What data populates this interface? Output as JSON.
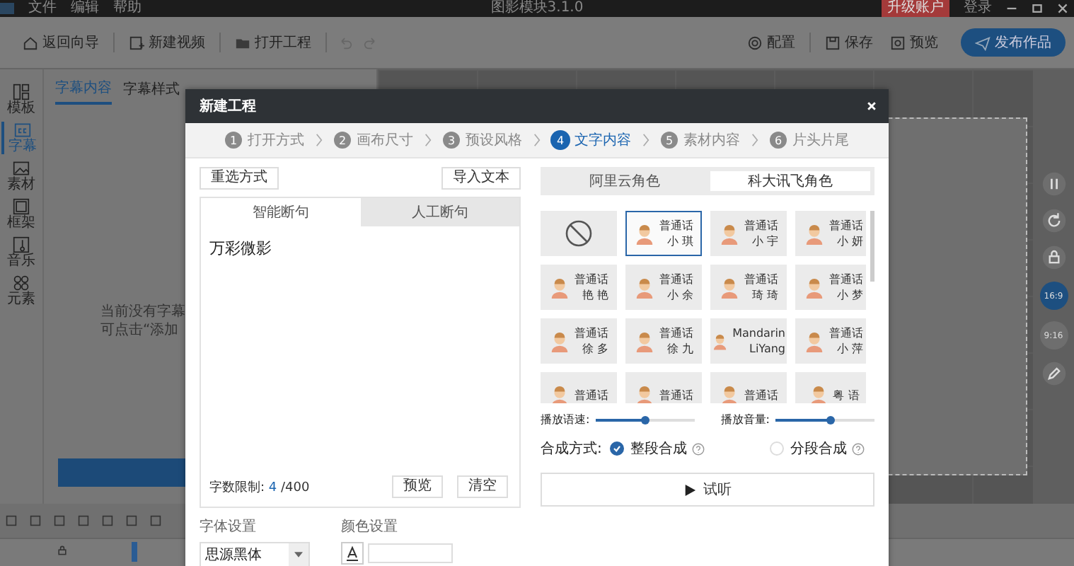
{
  "app": {
    "menu": [
      "文件",
      "编辑",
      "帮助"
    ],
    "title": "图影模块3.1.0",
    "upgrade": "升级账户",
    "login": "登录"
  },
  "toolbar": {
    "left": [
      "返回向导",
      "新建视频",
      "打开工程"
    ],
    "right": [
      "配置",
      "保存",
      "预览"
    ],
    "publish": "发布作品"
  },
  "sidebar": {
    "items": [
      {
        "label": "模板",
        "selected": false
      },
      {
        "label": "字幕",
        "selected": true
      },
      {
        "label": "素材",
        "selected": false
      },
      {
        "label": "框架",
        "selected": false
      },
      {
        "label": "音乐",
        "selected": false
      },
      {
        "label": "元素",
        "selected": false
      }
    ]
  },
  "panel": {
    "tabs": [
      {
        "label": "字幕内容",
        "selected": true
      },
      {
        "label": "字幕样式",
        "selected": false
      }
    ],
    "empty_lines": [
      "当前没有字幕",
      "可点击“添加"
    ]
  },
  "ratio_buttons": [
    {
      "label": "16:9",
      "selected": true
    },
    {
      "label": "9:16",
      "selected": false
    }
  ],
  "dialog": {
    "title": "新建工程",
    "steps": [
      {
        "number": "1",
        "label": "打开方式",
        "selected": false
      },
      {
        "number": "2",
        "label": "画布尺寸",
        "selected": false
      },
      {
        "number": "3",
        "label": "预设风格",
        "selected": false
      },
      {
        "number": "4",
        "label": "文字内容",
        "selected": true
      },
      {
        "number": "5",
        "label": "素材内容",
        "selected": false
      },
      {
        "number": "6",
        "label": "片头片尾",
        "selected": false
      }
    ],
    "reselect_button": "重选方式",
    "import_button": "导入文本",
    "text_tabs": [
      {
        "label": "智能断句",
        "selected": true
      },
      {
        "label": "人工断句",
        "selected": false
      }
    ],
    "text_value": "万彩微影",
    "limit_label": "字数限制:",
    "limit_count": "4",
    "limit_max": "/400",
    "preview_button": "预览",
    "clear_button": "清空",
    "font_label": "字体设置",
    "font_value": "思源黑体",
    "color_label": "颜色设置",
    "voice_tabs": [
      {
        "label": "阿里云角色",
        "selected": false
      },
      {
        "label": "科大讯飞角色",
        "selected": true
      }
    ],
    "voices": [
      {
        "kind": "none",
        "selected": false
      },
      {
        "kind": "voice",
        "line1": "普通话",
        "line2": "小 琪",
        "selected": true
      },
      {
        "kind": "voice",
        "line1": "普通话",
        "line2": "小 宇",
        "selected": false
      },
      {
        "kind": "voice",
        "line1": "普通话",
        "line2": "小 妍",
        "selected": false
      },
      {
        "kind": "voice",
        "line1": "普通话",
        "line2": "艳 艳",
        "selected": false
      },
      {
        "kind": "voice",
        "line1": "普通话",
        "line2": "小 余",
        "selected": false
      },
      {
        "kind": "voice",
        "line1": "普通话",
        "line2": "琦 琦",
        "selected": false
      },
      {
        "kind": "voice",
        "line1": "普通话",
        "line2": "小 梦",
        "selected": false
      },
      {
        "kind": "voice",
        "line1": "普通话",
        "line2": "徐 多",
        "selected": false
      },
      {
        "kind": "voice",
        "line1": "普通话",
        "line2": "徐 九",
        "selected": false
      },
      {
        "kind": "voice",
        "line1": "Mandarin",
        "line2": "LiYang",
        "selected": false
      },
      {
        "kind": "voice",
        "line1": "普通话",
        "line2": "小 萍",
        "selected": false
      },
      {
        "kind": "voice",
        "line1": "普通话",
        "selected": false
      },
      {
        "kind": "voice",
        "line1": "普通话",
        "selected": false
      },
      {
        "kind": "voice",
        "line1": "普通话",
        "selected": false
      },
      {
        "kind": "voice",
        "line1": "粤 语",
        "selected": false
      }
    ],
    "sliders": [
      {
        "label": "播放语速:",
        "level": 0.5
      },
      {
        "label": "播放音量:",
        "level": 0.55
      }
    ],
    "synthesis_label": "合成方式:",
    "synthesis_options": [
      {
        "label": "整段合成",
        "selected": true
      },
      {
        "label": "分段合成",
        "selected": false
      }
    ],
    "listen_button": "试听"
  }
}
